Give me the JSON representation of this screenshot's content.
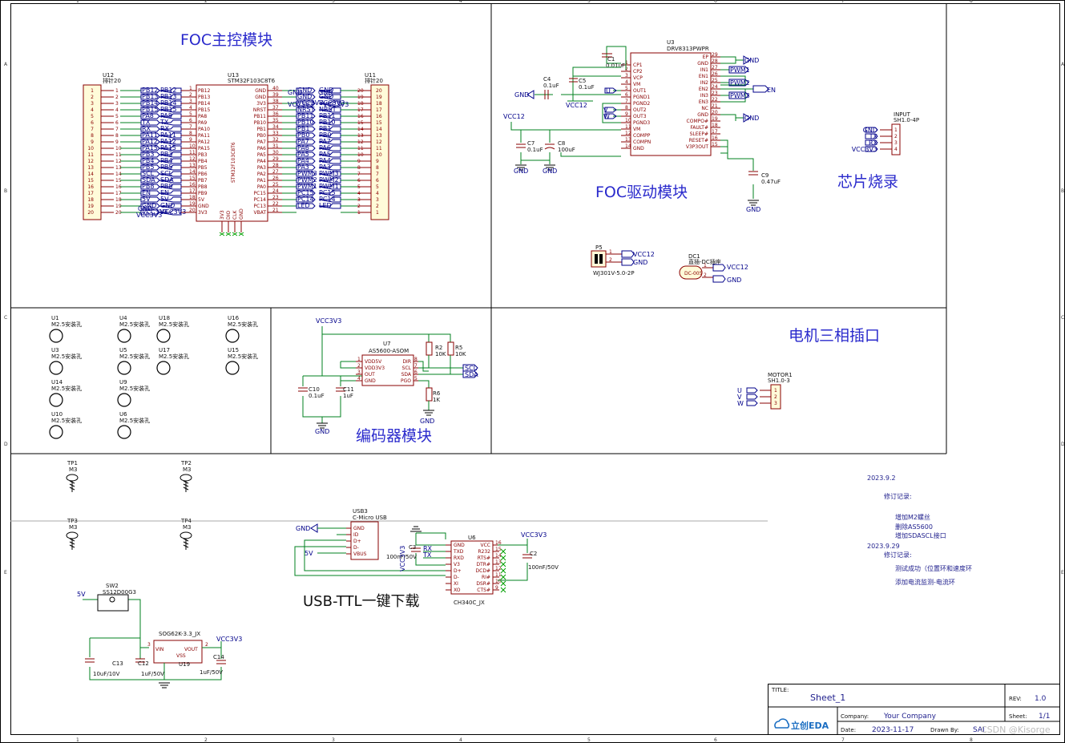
{
  "frame": {
    "cols": [
      "1",
      "2",
      "3",
      "4",
      "5",
      "6",
      "7",
      "8"
    ],
    "rows": [
      "A",
      "B",
      "C",
      "D",
      "E"
    ]
  },
  "blocks": {
    "foc_main": {
      "title": "FOC主控模块",
      "u12": {
        "ref": "U12",
        "value": "排针20"
      },
      "u13": {
        "ref": "U13",
        "value": "STM32F103C8T6",
        "body": "STM32F103C8T6"
      },
      "u11": {
        "ref": "U11",
        "value": "排针20"
      },
      "left_labels": [
        "PB12",
        "PB13",
        "PB14",
        "PB15",
        "PA8",
        "PA9",
        "PA10",
        "PA11",
        "PA12",
        "PA15",
        "PB3",
        "PB4",
        "PB5",
        "PB6",
        "PB7",
        "PB8",
        "PB9",
        "5V",
        "GND",
        "3V3"
      ],
      "right_labels": [
        "GND",
        "GND",
        "3V3",
        "NRST",
        "PB11",
        "PB10",
        "PB1",
        "PB0",
        "PA7",
        "PA6",
        "PA5",
        "PA4",
        "PA3",
        "PA2",
        "PA1",
        "PA0",
        "PC15",
        "PC14",
        "PC13",
        "VBAT"
      ],
      "left_nets": [
        "PB12",
        "PB13",
        "PB14",
        "PB15",
        "PA8",
        "TX",
        "RX",
        "PA11",
        "PA12",
        "PA15",
        "PB3",
        "PB4",
        "PB5",
        "SCL",
        "SDA",
        "PB8",
        "EN",
        "5V",
        "GND",
        "VCC3V3"
      ],
      "right_nets": [
        "GND",
        "GND",
        "VCC3V3",
        "NRST",
        "PB11",
        "PB10",
        "PB1",
        "PB0",
        "PA7",
        "PA6",
        "PA5",
        "PA4",
        "PA3",
        "PWM3",
        "PWM2",
        "PWM1",
        "PC15",
        "PC14",
        "LED",
        ""
      ],
      "bottom_pins": [
        "3V3",
        "DIO",
        "CLK",
        "GND"
      ],
      "net_gnd": "GND",
      "net_vcc": "VCC3V3"
    },
    "foc_drive": {
      "title": "FOC驱动模块",
      "u3": {
        "ref": "U3",
        "value": "DRV8313PWPR"
      },
      "left_pins": [
        "CP1",
        "CP2",
        "VCP",
        "VM",
        "OUT1",
        "PGND1",
        "PGND2",
        "OUT2",
        "OUT3",
        "PGND3",
        "VM",
        "COMPP",
        "COMPN",
        "GND"
      ],
      "left_nums": [
        "1",
        "2",
        "3",
        "4",
        "5",
        "6",
        "7",
        "8",
        "9",
        "10",
        "11",
        "12",
        "13",
        "14"
      ],
      "right_pins": [
        "EP",
        "GND",
        "IN1",
        "EN1",
        "IN2",
        "EN2",
        "IN3",
        "EN3",
        "NC",
        "GND",
        "COMPO#",
        "FAULT#",
        "SLEEP#",
        "RESET#",
        "V3P3OUT"
      ],
      "right_nums": [
        "29",
        "28",
        "27",
        "26",
        "25",
        "24",
        "23",
        "22",
        "21",
        "20",
        "19",
        "18",
        "17",
        "16",
        "15"
      ],
      "caps": [
        {
          "ref": "C1",
          "value": "0.01uF"
        },
        {
          "ref": "C4",
          "value": "0.1uF"
        },
        {
          "ref": "C5",
          "value": "0.1uF"
        },
        {
          "ref": "C7",
          "value": "0.1uF"
        },
        {
          "ref": "C8",
          "value": "100uF"
        },
        {
          "ref": "C9",
          "value": "0.47uF"
        }
      ],
      "nets": {
        "gnd": "GND",
        "vcc12": "VCC12",
        "pwm1": "PWM1",
        "pwm2": "PWM2",
        "pwm3": "PWM3",
        "en": "EN",
        "u": "U",
        "v": "V",
        "w": "W"
      },
      "p5": {
        "ref": "P5",
        "value": "WJ301V-5.0-2P",
        "pins": [
          "1",
          "2"
        ]
      },
      "dc1": {
        "ref": "DC1",
        "value": "直插-DC插座",
        "inner": "DC-005",
        "pins": [
          "1",
          "2",
          "3"
        ]
      }
    },
    "flash": {
      "title": "芯片烧录",
      "ref": "INPUT",
      "value": "SH1.0-4P",
      "nets": [
        "GND",
        "TX",
        "RX",
        "VCC3V3"
      ],
      "pins": [
        "1",
        "2",
        "3",
        "4"
      ]
    },
    "holes": {
      "items": [
        {
          "ref": "U1",
          "value": "M2.5安装孔"
        },
        {
          "ref": "U4",
          "value": "M2.5安装孔"
        },
        {
          "ref": "U18",
          "value": "M2.5安装孔"
        },
        {
          "ref": "U16",
          "value": "M2.5安装孔"
        },
        {
          "ref": "U3",
          "value": "M2.5安装孔"
        },
        {
          "ref": "U5",
          "value": "M2.5安装孔"
        },
        {
          "ref": "U17",
          "value": "M2.5安装孔"
        },
        {
          "ref": "U15",
          "value": "M2.5安装孔"
        },
        {
          "ref": "U14",
          "value": "M2.5安装孔"
        },
        {
          "ref": "U9",
          "value": "M2.5安装孔"
        },
        {
          "ref": "U10",
          "value": "M2.5安装孔"
        },
        {
          "ref": "U6",
          "value": "M2.5安装孔"
        }
      ]
    },
    "encoder": {
      "title": "编码器模块",
      "u7": {
        "ref": "U7",
        "value": "AS5600-ASOM"
      },
      "left_pins": [
        "VDD5V",
        "VDD3V3",
        "OUT",
        "GND"
      ],
      "right_pins": [
        "DIR",
        "SCL",
        "SDA",
        "PGO"
      ],
      "left_nums": [
        "1",
        "2",
        "3",
        "4"
      ],
      "right_nums": [
        "8",
        "7",
        "6",
        "5"
      ],
      "r2": {
        "ref": "R2",
        "value": "10K"
      },
      "r5": {
        "ref": "R5",
        "value": "10K"
      },
      "r6": {
        "ref": "R6",
        "value": "1K"
      },
      "c10": {
        "ref": "C10",
        "value": "0.1uF"
      },
      "c11": {
        "ref": "C11",
        "value": "1uF"
      },
      "nets": {
        "vcc": "VCC3V3",
        "gnd": "GND",
        "scl": "SCL",
        "sda": "SDA"
      }
    },
    "motor": {
      "title": "电机三相插口",
      "ref": "MOTOR1",
      "value": "SH1.0-3",
      "nets": [
        "U",
        "V",
        "W"
      ],
      "pins": [
        "1",
        "2",
        "3"
      ]
    },
    "tps": [
      {
        "ref": "TP1",
        "value": "M3"
      },
      {
        "ref": "TP2",
        "value": "M3"
      },
      {
        "ref": "TP3",
        "value": "M3"
      },
      {
        "ref": "TP4",
        "value": "M3"
      }
    ],
    "usb_ttl": {
      "title": "USB-TTL一键下载",
      "usb3": {
        "ref": "USB3",
        "value": "C-Micro USB",
        "pins": [
          "GND",
          "ID",
          "D+",
          "D-",
          "VBUS"
        ]
      },
      "u6": {
        "ref": "U6",
        "value": "CH340C_JX"
      },
      "left_pins": [
        "GND",
        "TXD",
        "RXD",
        "V3",
        "D+",
        "D-",
        "XI",
        "XO"
      ],
      "right_pins": [
        "VCC",
        "R232",
        "RTS#",
        "DTR#",
        "DCD#",
        "RI#",
        "DSR#",
        "CTS#"
      ],
      "right_nums": [
        "16",
        "15",
        "14",
        "13",
        "12",
        "11",
        "10",
        "9"
      ],
      "c3": {
        "ref": "C3",
        "value": "100nF/50V"
      },
      "c2": {
        "ref": "C2",
        "value": "100nF/50V"
      },
      "nets": {
        "gnd": "GND",
        "v5": "5V",
        "vcc": "VCC3V3",
        "rx": "RX",
        "tx": "TX"
      }
    },
    "power": {
      "sw2": {
        "ref": "SW2",
        "value": "SS12D00G3"
      },
      "reg": {
        "ref": "U19",
        "value": "SOG62K-3.3_JX",
        "pins": [
          "VIN",
          "VSS",
          "VOUT"
        ],
        "nums": [
          "3",
          "1",
          "2"
        ]
      },
      "c13": {
        "ref": "C13",
        "value": "10uF/10V"
      },
      "c12": {
        "ref": "C12",
        "value": "1uF/50V"
      },
      "c14": {
        "ref": "C14",
        "value": "1uF/50V"
      },
      "nets": {
        "v5": "5V",
        "vcc": "VCC3V3"
      }
    }
  },
  "revision_notes": {
    "date1": "2023.9.2",
    "header1": "修订记录:",
    "items1": [
      "增加M2螺丝",
      "删除AS5600",
      "增加SDASCL接口"
    ],
    "date2": "2023.9.29",
    "header2": "修订记录:",
    "items2": [
      "测试成功（位置环和速度环",
      "添加电流监测-电流环"
    ]
  },
  "title_block": {
    "title_label": "TITLE:",
    "title": "Sheet_1",
    "rev_label": "REV:",
    "rev": "1.0",
    "company_label": "Company:",
    "company": "Your Company",
    "sheet_label": "Sheet:",
    "sheet": "1/1",
    "date_label": "Date:",
    "date": "2023-11-17",
    "drawn_label": "Drawn By:",
    "drawn": "SAI",
    "logo": "立创EDA",
    "watermark": "CSDN @Kisorge"
  }
}
